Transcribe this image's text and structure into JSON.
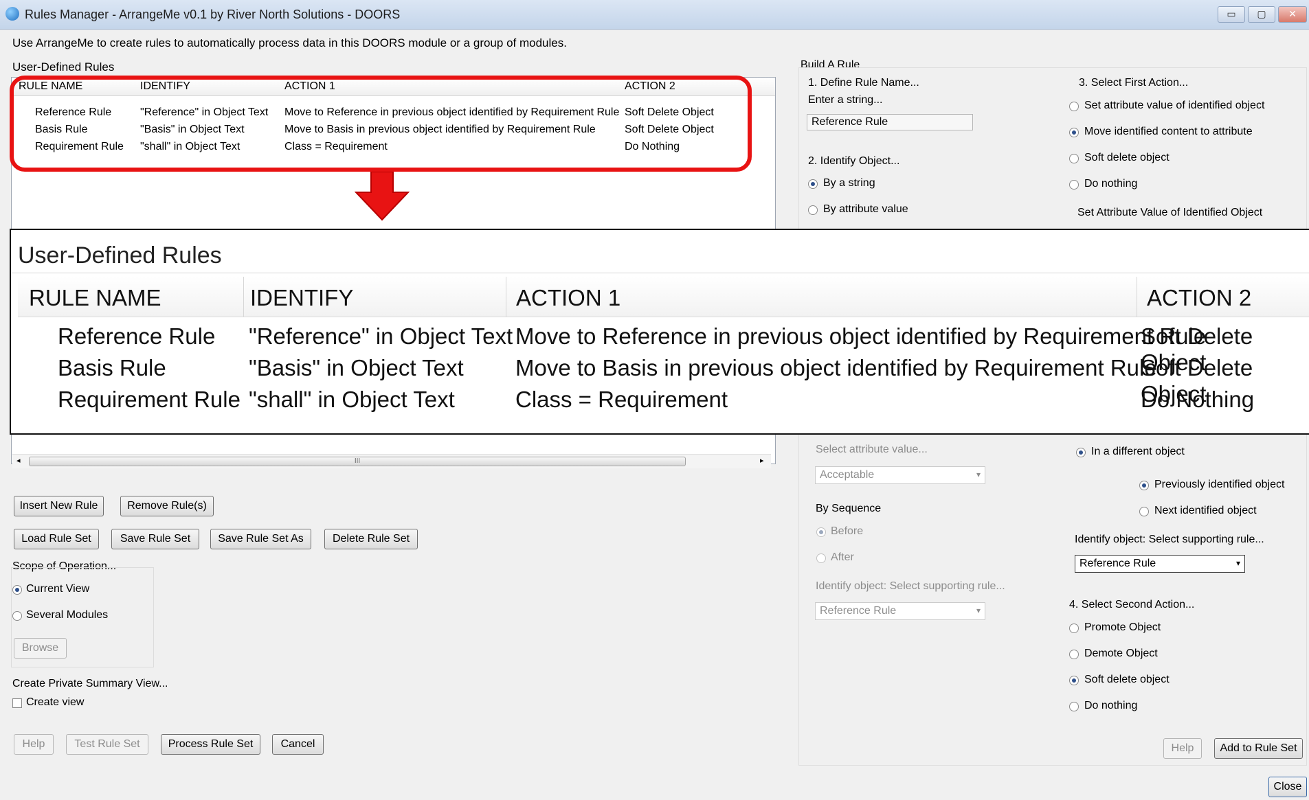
{
  "window": {
    "title": "Rules Manager - ArrangeMe v0.1 by River North Solutions - DOORS",
    "controls": [
      "▭",
      "▢",
      "✕"
    ]
  },
  "intro": "Use ArrangeMe to create rules to automatically process data in this DOORS module or a group of modules.",
  "rules_section": {
    "label": "User-Defined Rules",
    "columns": [
      "RULE NAME",
      "IDENTIFY",
      "ACTION 1",
      "ACTION 2"
    ],
    "rows": [
      [
        "Reference Rule",
        "\"Reference\" in Object Text",
        "Move to Reference in previous object identified by Requirement Rule",
        "Soft Delete Object"
      ],
      [
        "Basis Rule",
        "\"Basis\" in Object Text",
        "Move to Basis in previous object identified by Requirement Rule",
        "Soft Delete Object"
      ],
      [
        "Requirement Rule",
        "\"shall\" in Object Text",
        "Class = Requirement",
        "Do Nothing"
      ]
    ],
    "scroll_thumb_label": "III"
  },
  "buttons": {
    "insert": "Insert New Rule",
    "remove": "Remove Rule(s)",
    "load": "Load Rule Set",
    "save": "Save Rule Set",
    "save_as": "Save Rule Set As",
    "delete": "Delete Rule Set",
    "browse": "Browse",
    "help": "Help",
    "test": "Test Rule Set",
    "process": "Process Rule Set",
    "cancel": "Cancel",
    "help2": "Help",
    "add": "Add to Rule Set",
    "close": "Close"
  },
  "scope": {
    "label": "Scope of Operation...",
    "current": "Current View",
    "several": "Several Modules"
  },
  "summary": {
    "label": "Create Private Summary View...",
    "checkbox": "Create view"
  },
  "build": {
    "label": "Build A Rule",
    "step1": {
      "label": "1. Define Rule Name...",
      "sub": "Enter a string...",
      "value": "Reference Rule"
    },
    "step2": {
      "label": "2. Identify Object...",
      "by_string": "By a string",
      "by_attr": "By attribute value"
    },
    "attr_select": {
      "label": "Select attribute value...",
      "value": "Acceptable"
    },
    "sequence": {
      "label": "By Sequence",
      "before": "Before",
      "after": "After",
      "support_label": "Identify object: Select supporting rule...",
      "support_value": "Reference Rule"
    },
    "step3": {
      "label": "3. Select First Action...",
      "opt1": "Set attribute value of identified object",
      "opt2": "Move identified content to attribute",
      "opt3": "Soft delete object",
      "opt4": "Do nothing",
      "set_attr_label": "Set Attribute Value of Identified Object"
    },
    "diff_obj": {
      "label": "In a different object",
      "prev": "Previously identified object",
      "next": "Next identified object",
      "support_label": "Identify object: Select supporting rule...",
      "support_value": "Reference Rule"
    },
    "step4": {
      "label": "4. Select Second Action...",
      "opt1": "Promote Object",
      "opt2": "Demote Object",
      "opt3": "Soft delete object",
      "opt4": "Do nothing"
    }
  },
  "colors": {
    "highlight": "#e81313",
    "accent": "#2d4f8a"
  }
}
